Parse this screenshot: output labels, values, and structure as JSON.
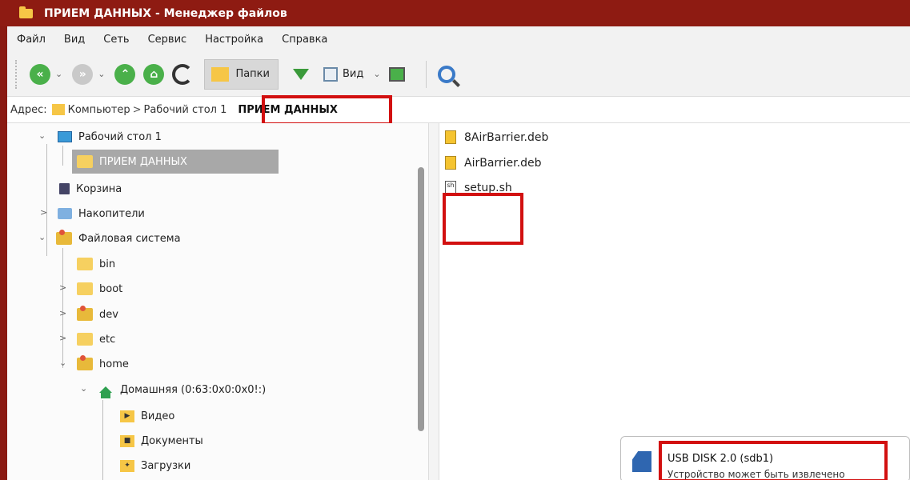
{
  "window": {
    "title": "ПРИЕМ ДАННЫХ - Менеджер файлов"
  },
  "menu": [
    "Файл",
    "Вид",
    "Сеть",
    "Сервис",
    "Настройка",
    "Справка"
  ],
  "toolbar": {
    "folders_label": "Папки",
    "view_label": "Вид"
  },
  "address": {
    "label": "Адрес:",
    "crumbs": [
      "Компьютер",
      "Рабочий стол 1"
    ],
    "current": "ПРИЕМ ДАННЫХ"
  },
  "tree": {
    "desktop": "Рабочий стол 1",
    "selected": "ПРИЕМ ДАННЫХ",
    "trash": "Корзина",
    "drives": "Накопители",
    "filesystem": "Файловая система",
    "bin": "bin",
    "boot": "boot",
    "dev": "dev",
    "etc": "etc",
    "home": "home",
    "home_user": "Домашняя (0:63:0x0:0x0!:)",
    "video": "Видео",
    "documents": "Документы",
    "downloads": "Загрузки"
  },
  "files": [
    {
      "name": "8AirBarrier.deb",
      "icon": "deb-package-icon"
    },
    {
      "name": "AirBarrier.deb",
      "icon": "deb-package-icon"
    },
    {
      "name": "setup.sh",
      "icon": "shell-script-icon"
    }
  ],
  "notification": {
    "title": "USB DISK 2.0 (sdb1)",
    "body": "Устройство может быть извлечено"
  },
  "colors": {
    "titlebar": "#8e1b12",
    "highlight": "#d21010",
    "selection": "#a8a8a8"
  }
}
